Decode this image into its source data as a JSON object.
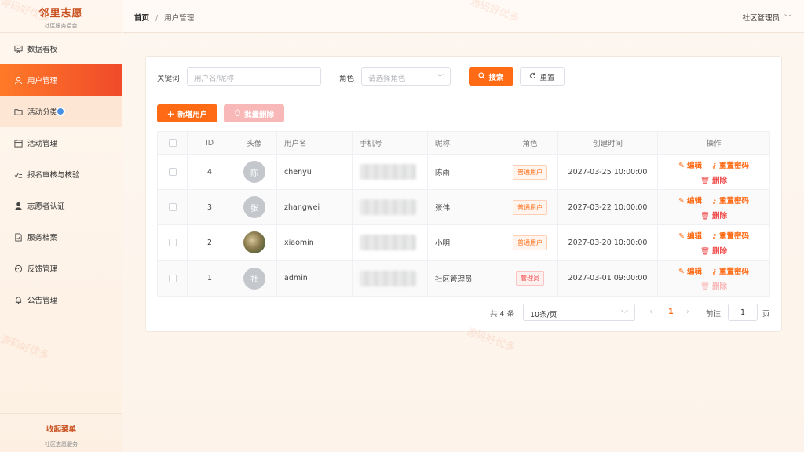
{
  "sidebar": {
    "brand_title": "邻里志愿",
    "brand_sub": "社区服务后台",
    "items": [
      {
        "label": "数据看板",
        "icon": "dashboard-icon"
      },
      {
        "label": "用户管理",
        "icon": "user-icon"
      },
      {
        "label": "活动分类",
        "icon": "folder-icon"
      },
      {
        "label": "活动管理",
        "icon": "calendar-icon"
      },
      {
        "label": "报名审核与核验",
        "icon": "checklist-icon"
      },
      {
        "label": "志愿者认证",
        "icon": "person-icon"
      },
      {
        "label": "服务档案",
        "icon": "file-icon"
      },
      {
        "label": "反馈管理",
        "icon": "chat-icon"
      },
      {
        "label": "公告管理",
        "icon": "bell-icon"
      }
    ],
    "active_index": 1,
    "collapse_label": "收起菜单",
    "collapse_sub": "社区志愿服务"
  },
  "header": {
    "breadcrumb_home": "首页",
    "breadcrumb_sep": "/",
    "breadcrumb_current": "用户管理",
    "user_name": "社区管理员"
  },
  "filter": {
    "keyword_label": "关键词",
    "keyword_placeholder": "用户名/昵称",
    "role_label": "角色",
    "role_placeholder": "请选择角色",
    "search_label": "搜索",
    "reset_label": "重置"
  },
  "actions": {
    "add_label": "新增用户",
    "batch_delete_label": "批量删除"
  },
  "table": {
    "columns": [
      "ID",
      "头像",
      "用户名",
      "手机号",
      "昵称",
      "角色",
      "创建时间",
      "操作"
    ],
    "rows": [
      {
        "id": "4",
        "avatar": "陈",
        "username": "chenyu",
        "nickname": "陈雨",
        "role": "普通用户",
        "created": "2027-03-25 10:00:00",
        "edit": "编辑",
        "reset": "重置密码",
        "delete": "删除"
      },
      {
        "id": "3",
        "avatar": "张",
        "username": "zhangwei",
        "nickname": "张伟",
        "role": "普通用户",
        "created": "2027-03-22 10:00:00",
        "edit": "编辑",
        "reset": "重置密码",
        "delete": "删除"
      },
      {
        "id": "2",
        "avatar": "",
        "username": "xiaomin",
        "nickname": "小明",
        "role": "普通用户",
        "created": "2027-03-20 10:00:00",
        "edit": "编辑",
        "reset": "重置密码",
        "delete": "删除"
      },
      {
        "id": "1",
        "avatar": "社",
        "username": "admin",
        "nickname": "社区管理员",
        "role": "管理员",
        "created": "2027-03-01 09:00:00",
        "edit": "编辑",
        "reset": "重置密码",
        "delete": "删除"
      }
    ]
  },
  "pagination": {
    "total": "共 4 条",
    "page_size": "10条/页",
    "current": "1",
    "goto_label": "前往",
    "goto_value": "1",
    "page_suffix": "页"
  },
  "watermark": "源码好优多",
  "colors": {
    "accent": "#ff6a14",
    "danger": "#f04a4a",
    "brand": "#c8501e"
  }
}
